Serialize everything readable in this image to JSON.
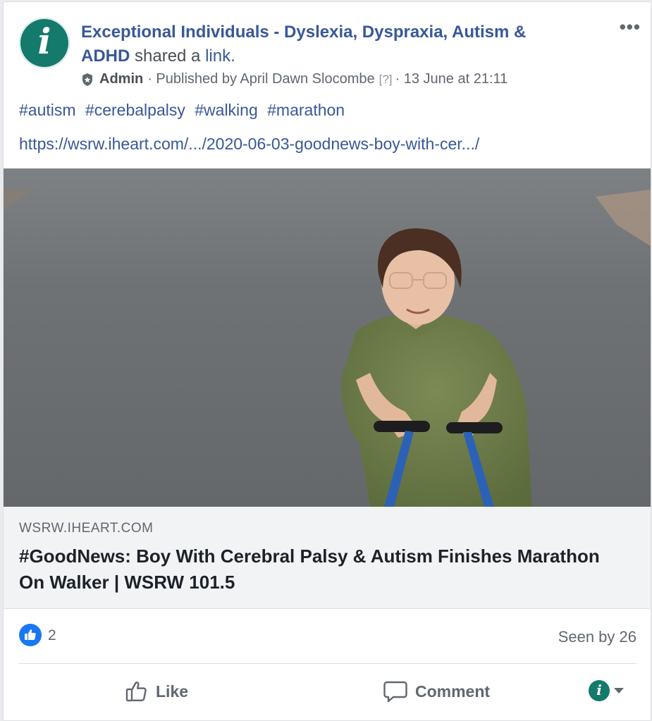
{
  "post": {
    "page_name": "Exceptional Individuals - Dyslexia, Dyspraxia, Autism & ADHD",
    "shared_text": "shared a",
    "link_word": "link.",
    "avatar_glyph": "i",
    "more_label": "•••",
    "meta": {
      "role": "Admin",
      "published_by": "· Published by April Dawn Slocombe",
      "help_marker": "[?]",
      "timestamp": "· 13 June at 21:11"
    },
    "hashtags": [
      "#autism",
      "#cerebalpalsy",
      "#walking",
      "#marathon"
    ],
    "url": "https://wsrw.iheart.com/.../2020-06-03-goodnews-boy-with-cer.../"
  },
  "link_preview": {
    "domain": "WSRW.IHEART.COM",
    "title": "#GoodNews: Boy With Cerebral Palsy & Autism Finishes Marathon On Walker | WSRW 101.5"
  },
  "stats": {
    "like_count": "2",
    "seen_by": "Seen by 26"
  },
  "actions": {
    "like_label": "Like",
    "comment_label": "Comment",
    "selector_glyph": "i"
  },
  "colors": {
    "link_blue": "#385898",
    "brand_teal": "#137a6c",
    "like_blue": "#1877f2",
    "muted_gray": "#606770"
  },
  "icons": {
    "more": "more-dots-icon",
    "admin": "shield-icon",
    "like_reaction": "thumbs-up-icon",
    "like_action": "thumbs-up-outline-icon",
    "comment_action": "speech-bubble-icon",
    "selector": "chevron-down-icon"
  }
}
